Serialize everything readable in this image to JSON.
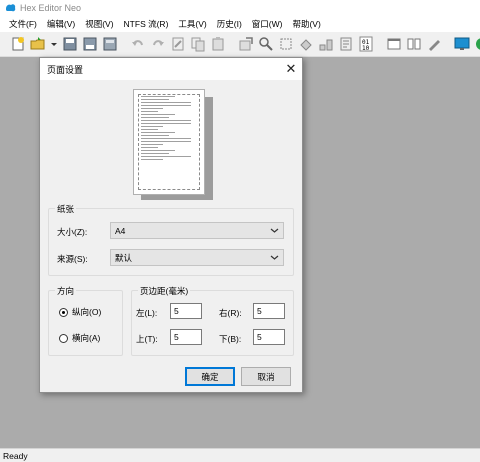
{
  "app": {
    "title": "Hex Editor Neo"
  },
  "menu": [
    "文件(F)",
    "编辑(V)",
    "视图(V)",
    "NTFS 流(R)",
    "工具(V)",
    "历史(I)",
    "窗口(W)",
    "帮助(V)"
  ],
  "toolbar_icons": [
    "new-file-icon",
    "open-folder-icon",
    "dropdown-arrow-icon",
    "save-icon",
    "save-copy-icon",
    "save-all-icon",
    "undo-icon",
    "redo-icon",
    "edit-icon",
    "copy-icon",
    "paste-icon",
    "export-icon",
    "find-icon",
    "select-icon",
    "fill-icon",
    "structure-icon",
    "properties-icon",
    "binary-icon",
    "window-icon",
    "tile-icon",
    "pen-icon",
    "monitor-icon",
    "help-icon"
  ],
  "dialog": {
    "title": "页面设置",
    "close": "✕",
    "paper": {
      "legend": "纸张",
      "size_label": "大小(Z):",
      "size_value": "A4",
      "source_label": "来源(S):",
      "source_value": "默认"
    },
    "orientation": {
      "legend": "方向",
      "portrait": "纵向(O)",
      "landscape": "横向(A)",
      "selected": "portrait"
    },
    "margins": {
      "legend": "页边距(毫米)",
      "left_label": "左(L):",
      "left_value": "5",
      "right_label": "右(R):",
      "right_value": "5",
      "top_label": "上(T):",
      "top_value": "5",
      "bottom_label": "下(B):",
      "bottom_value": "5"
    },
    "ok": "确定",
    "cancel": "取消"
  },
  "status": {
    "text": "Ready"
  }
}
